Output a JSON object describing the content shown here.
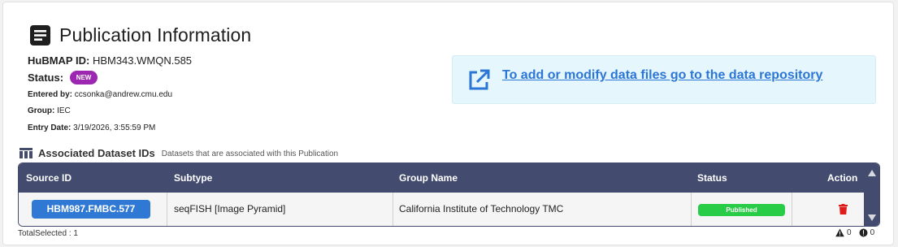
{
  "header": {
    "title": "Publication Information",
    "title_icon": "document-list-icon"
  },
  "meta": {
    "hubmap_id_label": "HuBMAP ID:",
    "hubmap_id_value": "HBM343.WMQN.585",
    "status_label": "Status:",
    "status_badge": "NEW",
    "entered_by_label": "Entered by:",
    "entered_by_value": "ccsonka@andrew.cmu.edu",
    "group_label": "Group:",
    "group_value": "IEC",
    "entry_date_label": "Entry Date:",
    "entry_date_value": "3/19/2026, 3:55:59 PM"
  },
  "repository": {
    "link_text": "To add or modify data files go to the data repository",
    "icon": "external-link-icon"
  },
  "associated": {
    "title": "Associated Dataset IDs",
    "subtitle": "Datasets that are associated with this Publication",
    "icon": "table-icon",
    "columns": [
      "Source ID",
      "Subtype",
      "Group Name",
      "Status",
      "Action"
    ],
    "rows": [
      {
        "source_id": "HBM987.FMBC.577",
        "subtype": "seqFISH [Image Pyramid]",
        "group_name": "California Institute of Technology TMC",
        "status": "Published",
        "action_icon": "trash-icon"
      }
    ]
  },
  "footer": {
    "total_selected": "TotalSelected : 1",
    "warnings": "0",
    "errors": "0"
  },
  "colors": {
    "header_bg": "#434b6e",
    "primary": "#2f78d4",
    "published": "#28cc47",
    "new_badge": "#9c27b0",
    "delete": "#e01b1b",
    "repo_bg": "#e5f6fc"
  }
}
